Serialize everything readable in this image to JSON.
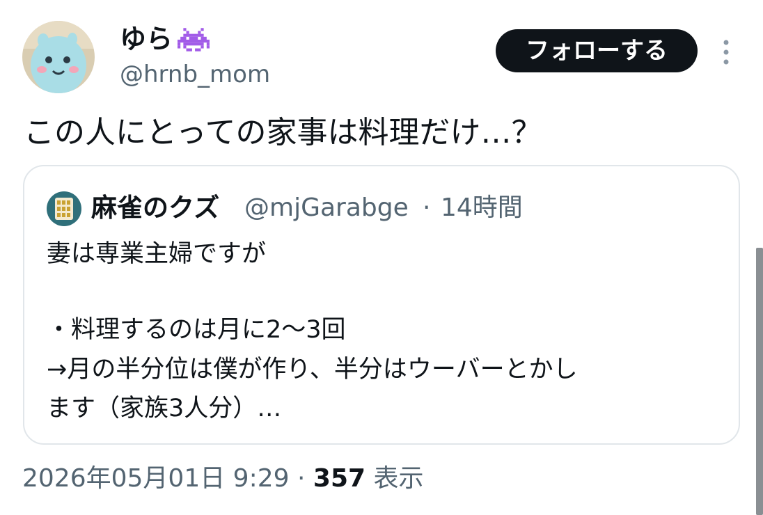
{
  "author": {
    "display_name": "ゆら",
    "handle": "@hrnb_mom",
    "avatar_icon": "plush-toy-avatar",
    "name_emoji_icon": "space-invader-icon"
  },
  "follow_button": {
    "label": "フォローする"
  },
  "more_menu": {
    "icon": "vertical-ellipsis-icon"
  },
  "tweet": {
    "text": "この人にとっての家事は料理だけ…？"
  },
  "quoted_tweet": {
    "display_name": "麻雀のクズ",
    "handle": "@mjGarabge",
    "separator": "·",
    "time": "14時間",
    "avatar_icon": "mahjong-tiles-avatar",
    "lines": [
      "妻は専業主婦ですが",
      "",
      "・料理するのは月に2〜3回",
      "→月の半分位は僕が作り、半分はウーバーとかし",
      "ます（家族3人分）…"
    ]
  },
  "footer": {
    "timestamp": "2026年05月01日 9:29",
    "separator": "·",
    "views_count": "357",
    "views_label": "表示"
  },
  "colors": {
    "text_primary": "#0f1419",
    "text_secondary": "#536471",
    "card_border": "#e1e6ea",
    "button_bg": "#0f1419",
    "invader": "#a25ce8"
  }
}
